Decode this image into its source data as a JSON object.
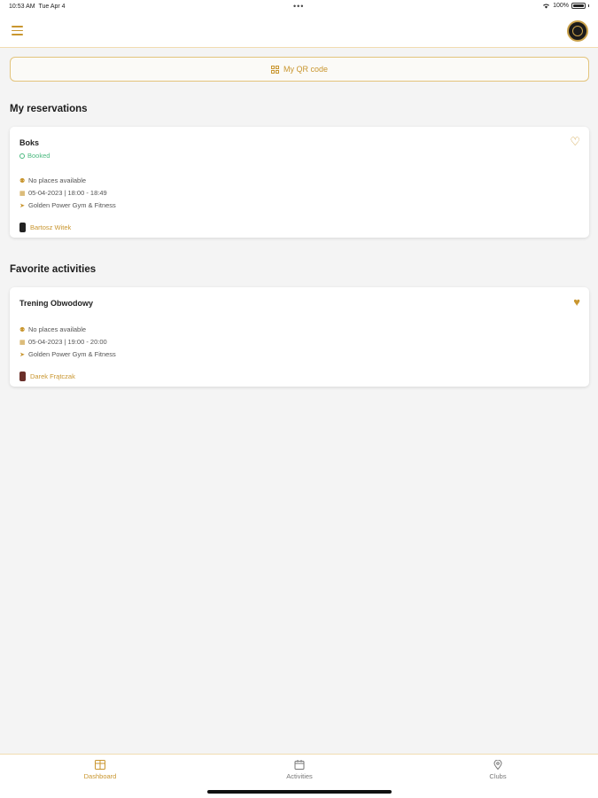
{
  "status_bar": {
    "time": "10:53 AM",
    "date": "Tue Apr 4",
    "battery": "100%"
  },
  "header": {
    "menu_icon": "hamburger-menu-icon",
    "logo_icon": "club-logo-icon"
  },
  "qr_button": {
    "label": "My QR code",
    "icon": "qr-code-icon"
  },
  "reservations": {
    "title": "My reservations",
    "items": [
      {
        "name": "Boks",
        "status": "Booked",
        "availability": "No places available",
        "datetime": "05-04-2023 | 18:00 - 18:49",
        "location": "Golden Power Gym & Fitness",
        "trainer": "Bartosz Witek",
        "favorite": false
      }
    ]
  },
  "favorites": {
    "title": "Favorite activities",
    "items": [
      {
        "name": "Trening Obwodowy",
        "availability": "No places available",
        "datetime": "05-04-2023 | 19:00 - 20:00",
        "location": "Golden Power Gym & Fitness",
        "trainer": "Darek Frątczak",
        "favorite": true
      }
    ]
  },
  "tabs": [
    {
      "label": "Dashboard",
      "icon": "dashboard-icon",
      "active": true
    },
    {
      "label": "Activities",
      "icon": "calendar-icon",
      "active": false
    },
    {
      "label": "Clubs",
      "icon": "location-pin-icon",
      "active": false
    }
  ],
  "colors": {
    "accent": "#c9962f",
    "status_booked": "#4bb97f",
    "background": "#f4f4f4"
  }
}
